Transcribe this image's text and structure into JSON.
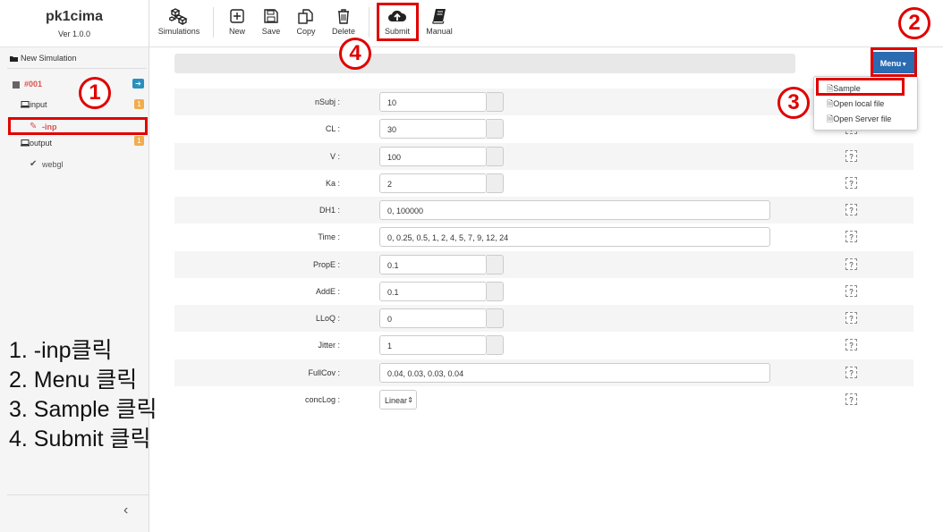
{
  "app": {
    "title": "pk1cima",
    "version": "Ver 1.0.0"
  },
  "toolbar": [
    {
      "label": "Simulations",
      "icon": "cubes-icon"
    },
    {
      "label": "New",
      "icon": "plus-square-icon"
    },
    {
      "label": "Save",
      "icon": "save-icon"
    },
    {
      "label": "Copy",
      "icon": "copy-icon"
    },
    {
      "label": "Delete",
      "icon": "trash-icon"
    },
    {
      "label": "Submit",
      "icon": "cloud-upload-icon"
    },
    {
      "label": "Manual",
      "icon": "book-icon"
    }
  ],
  "sidebar": {
    "new_simulation": "New Simulation",
    "sim_id": "#001",
    "input_label": "input",
    "input_count": "1",
    "inp_file": "-inp",
    "output_label": "output",
    "output_count": "1",
    "webgl": "webgl"
  },
  "menu": {
    "button_label": "Menu",
    "items": [
      "Sample",
      "Open local file",
      "Open Server file"
    ]
  },
  "params": [
    {
      "label": "nSubj :",
      "value": "10"
    },
    {
      "label": "CL :",
      "value": "30"
    },
    {
      "label": "V :",
      "value": "100"
    },
    {
      "label": "Ka :",
      "value": "2"
    },
    {
      "label": "DH1 :",
      "value": "0, 100000"
    },
    {
      "label": "Time :",
      "value": "0, 0.25, 0.5, 1, 2, 4, 5, 7, 9, 12, 24"
    },
    {
      "label": "PropE :",
      "value": "0.1"
    },
    {
      "label": "AddE :",
      "value": "0.1"
    },
    {
      "label": "LLoQ :",
      "value": "0"
    },
    {
      "label": "Jitter :",
      "value": "1"
    },
    {
      "label": "FullCov :",
      "value": "0.04, 0.03, 0.03, 0.04"
    },
    {
      "label": "concLog :",
      "value": "Linear"
    }
  ],
  "help_label": "?",
  "annotations": {
    "circles": [
      "1",
      "2",
      "3",
      "4"
    ],
    "steps": [
      "1. -inp클릭",
      "2. Menu 클릭",
      "3. Sample 클릭",
      "4. Submit 클릭"
    ]
  },
  "colors": {
    "accent": "#2a6bb1",
    "highlight": "#e00000",
    "active": "#d9534f",
    "info": "#2a8fbd",
    "warning": "#f0ad4e"
  }
}
